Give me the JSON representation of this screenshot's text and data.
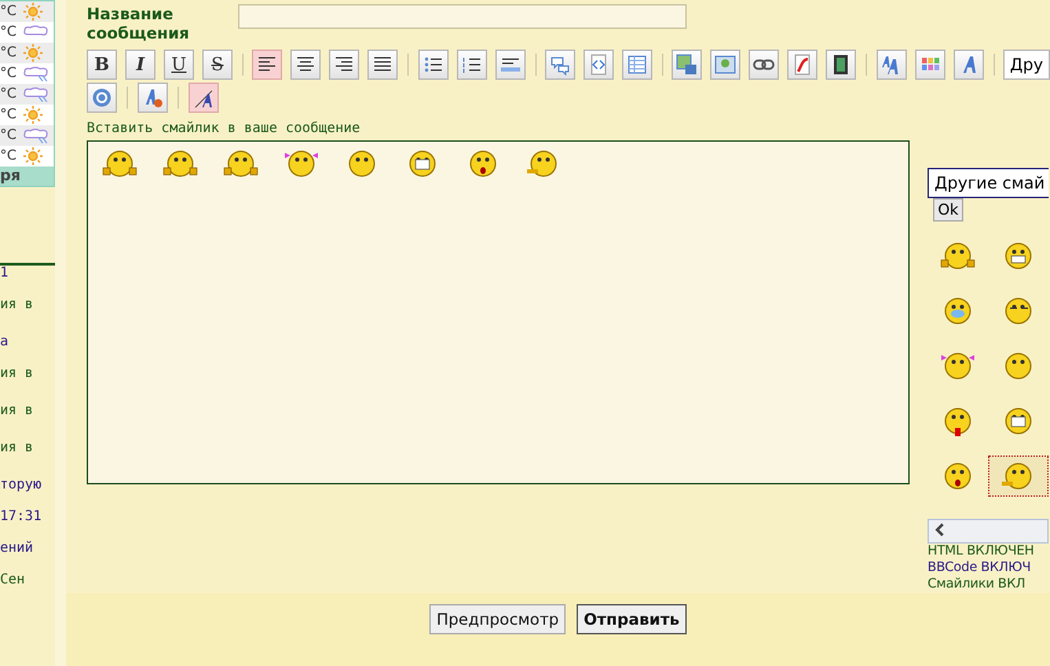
{
  "sidebar": {
    "weather": [
      {
        "temp": "°C",
        "kind": "sun"
      },
      {
        "temp": "°C",
        "kind": "cloud"
      },
      {
        "temp": "°C",
        "kind": "sun"
      },
      {
        "temp": "°C",
        "kind": "rain"
      },
      {
        "temp": "°C",
        "kind": "rain"
      },
      {
        "temp": "°C",
        "kind": "sun"
      },
      {
        "temp": "°C",
        "kind": "rain"
      },
      {
        "temp": "°C",
        "kind": "sun"
      }
    ],
    "weather_footer": "ря",
    "fragments": [
      {
        "text": "1",
        "kind": "link"
      },
      {
        "text": "ия в",
        "kind": "plain"
      },
      {
        "text": "а",
        "kind": "link"
      },
      {
        "text": "ия в",
        "kind": "plain"
      },
      {
        "text": "ия в",
        "kind": "plain"
      },
      {
        "text": "ия в",
        "kind": "plain"
      },
      {
        "text": "торую",
        "kind": "link"
      },
      {
        "text": "17:31",
        "kind": "link"
      },
      {
        "text": "ений",
        "kind": "link"
      },
      {
        "text": "Сен",
        "kind": "plain"
      }
    ]
  },
  "subject": {
    "label": "Название сообщения"
  },
  "toolbar": {
    "rows": [
      [
        {
          "kind": "bold",
          "label": "B",
          "selected": false
        },
        {
          "kind": "italic",
          "label": "I",
          "selected": false
        },
        {
          "kind": "underline",
          "label": "U",
          "selected": false
        },
        {
          "kind": "strike",
          "label": "S",
          "selected": false
        },
        {
          "kind": "sep"
        },
        {
          "kind": "alignleft",
          "selected": true
        },
        {
          "kind": "aligncenter",
          "selected": false
        },
        {
          "kind": "alignright",
          "selected": false
        },
        {
          "kind": "justify",
          "selected": false
        },
        {
          "kind": "sep"
        },
        {
          "kind": "bullets",
          "selected": false
        },
        {
          "kind": "numbers",
          "selected": false
        },
        {
          "kind": "rule",
          "selected": false
        },
        {
          "kind": "sep"
        },
        {
          "kind": "quote",
          "selected": false
        },
        {
          "kind": "code",
          "selected": false
        },
        {
          "kind": "table",
          "selected": false
        },
        {
          "kind": "sep"
        },
        {
          "kind": "imagesave",
          "selected": false
        },
        {
          "kind": "image",
          "selected": false
        },
        {
          "kind": "link",
          "selected": false
        },
        {
          "kind": "flash",
          "selected": false
        },
        {
          "kind": "video",
          "selected": false
        },
        {
          "kind": "sep"
        },
        {
          "kind": "fontsize",
          "selected": false
        },
        {
          "kind": "color",
          "selected": false
        },
        {
          "kind": "font",
          "selected": false
        },
        {
          "kind": "sep"
        },
        {
          "kind": "dropdown",
          "label": "Дру"
        }
      ],
      [
        {
          "kind": "help",
          "selected": false
        },
        {
          "kind": "sep"
        },
        {
          "kind": "removeformat",
          "selected": false
        },
        {
          "kind": "sep"
        },
        {
          "kind": "textsize",
          "selected": true
        }
      ]
    ]
  },
  "smiley_caption": "Вставить смайлик в ваше сообщение",
  "message_smileys": [
    {
      "kind": "hands"
    },
    {
      "kind": "hands"
    },
    {
      "kind": "hands"
    },
    {
      "kind": "bows"
    },
    {
      "kind": "plain"
    },
    {
      "kind": "teeth"
    },
    {
      "kind": "shock"
    },
    {
      "kind": "lying"
    }
  ],
  "smiley_panel": {
    "select": "Другие смай",
    "ok": "Ok",
    "smileys": [
      {
        "kind": "hands",
        "selected": false
      },
      {
        "kind": "grin",
        "selected": false
      },
      {
        "kind": "cry",
        "selected": false
      },
      {
        "kind": "wink",
        "selected": false
      },
      {
        "kind": "bows",
        "selected": false
      },
      {
        "kind": "plain",
        "selected": false
      },
      {
        "kind": "tongue",
        "selected": false
      },
      {
        "kind": "teeth",
        "selected": false
      },
      {
        "kind": "shock",
        "selected": false
      },
      {
        "kind": "lying",
        "selected": true
      }
    ],
    "status": [
      {
        "text": "HTML ВКЛЮЧЕН",
        "kind": "on"
      },
      {
        "text": "BBCode ВКЛЮЧ",
        "kind": "link"
      },
      {
        "text": "Смайлики ВКЛ",
        "kind": "on"
      }
    ]
  },
  "buttons": [
    {
      "label": "Предпросмотр",
      "primary": false
    },
    {
      "label": "Отправить",
      "primary": true
    }
  ]
}
